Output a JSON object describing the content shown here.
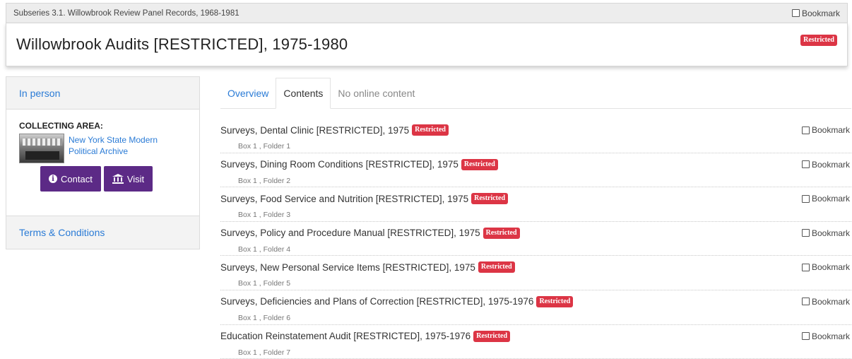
{
  "topbar": {
    "breadcrumb": "Subseries 3.1. Willowbrook Review Panel Records, 1968-1981",
    "bookmark_label": "Bookmark"
  },
  "header": {
    "title": "Willowbrook Audits [RESTRICTED], 1975-1980",
    "badge": "Restricted"
  },
  "sidebar": {
    "in_person": "In person",
    "collecting_area_label": "COLLECTING AREA:",
    "collecting_area_link": "New York State Modern Political Archive",
    "contact_label": "Contact",
    "visit_label": "Visit",
    "terms_link": "Terms & Conditions"
  },
  "tabs": [
    {
      "label": "Overview"
    },
    {
      "label": "Contents"
    },
    {
      "label": "No online content"
    }
  ],
  "items": [
    {
      "title": "Surveys, Dental Clinic [RESTRICTED], 1975",
      "badge": "Restricted",
      "location": "Box 1 , Folder 1",
      "bookmark": "Bookmark"
    },
    {
      "title": "Surveys, Dining Room Conditions [RESTRICTED], 1975",
      "badge": "Restricted",
      "location": "Box 1 , Folder 2",
      "bookmark": "Bookmark"
    },
    {
      "title": "Surveys, Food Service and Nutrition [RESTRICTED], 1975",
      "badge": "Restricted",
      "location": "Box 1 , Folder 3",
      "bookmark": "Bookmark"
    },
    {
      "title": "Surveys, Policy and Procedure Manual [RESTRICTED], 1975",
      "badge": "Restricted",
      "location": "Box 1 , Folder 4",
      "bookmark": "Bookmark"
    },
    {
      "title": "Surveys, New Personal Service Items [RESTRICTED], 1975",
      "badge": "Restricted",
      "location": "Box 1 , Folder 5",
      "bookmark": "Bookmark"
    },
    {
      "title": "Surveys, Deficiencies and Plans of Correction [RESTRICTED], 1975-1976",
      "badge": "Restricted",
      "location": "Box 1 , Folder 6",
      "bookmark": "Bookmark"
    },
    {
      "title": "Education Reinstatement Audit [RESTRICTED], 1975-1976",
      "badge": "Restricted",
      "location": "Box 1 , Folder 7",
      "bookmark": "Bookmark"
    }
  ],
  "colors": {
    "accent_link": "#2a7bd6",
    "badge_red": "#dc3545",
    "button_purple": "#5c2a86"
  }
}
